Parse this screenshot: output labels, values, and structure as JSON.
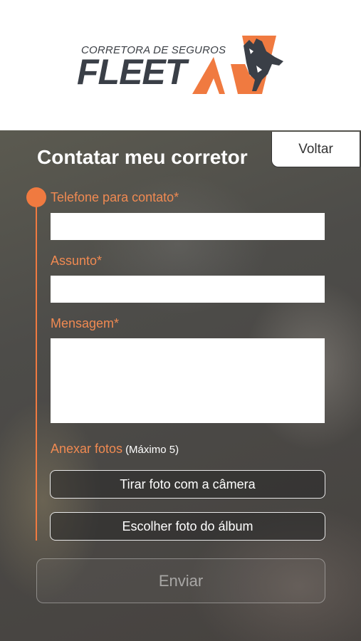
{
  "header": {
    "logo_tagline": "CORRETORA DE SEGUROS",
    "logo_word": "FLEET",
    "brand_color": "#f07a40",
    "logo_icon": "rhino-icon"
  },
  "back_button_label": "Voltar",
  "page_title": "Contatar meu corretor",
  "form": {
    "phone_label": "Telefone para contato*",
    "phone_value": "",
    "subject_label": "Assunto*",
    "subject_value": "",
    "message_label": "Mensagem*",
    "message_value": ""
  },
  "attachments": {
    "label": "Anexar fotos",
    "hint": "(Máximo 5)",
    "camera_button": "Tirar foto com a câmera",
    "album_button": "Escolher foto do álbum"
  },
  "send_button": "Enviar",
  "accent_color": "#f07a40"
}
